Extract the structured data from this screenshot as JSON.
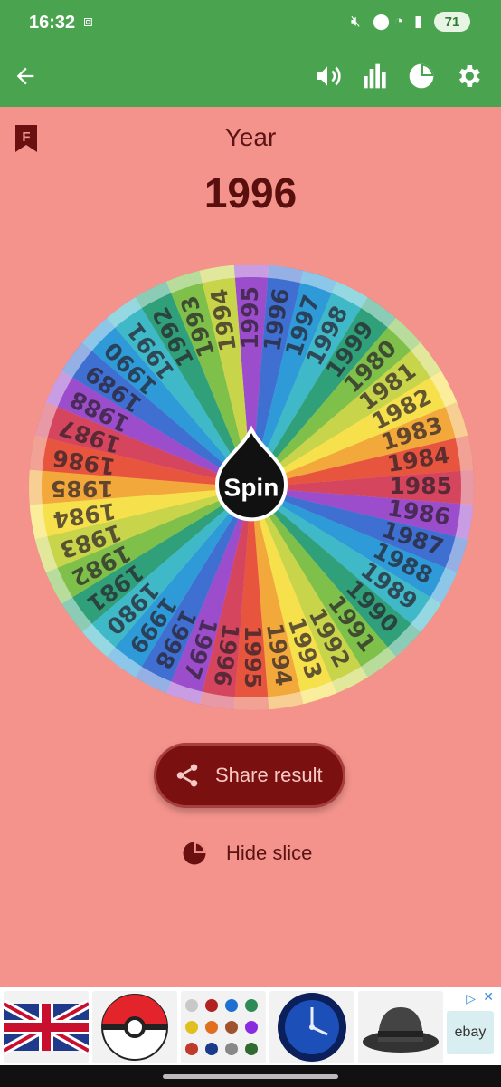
{
  "status": {
    "time": "16:32",
    "battery": "71",
    "icons": [
      "screenshot-icon",
      "mute-icon",
      "location-icon",
      "wifi-icon",
      "signal-icon"
    ]
  },
  "appbar": {
    "back": "back-arrow-icon",
    "actions": [
      "volume-icon",
      "stats-icon",
      "pie-icon",
      "settings-icon"
    ]
  },
  "wheel_title": "Year",
  "result": "1996",
  "spin_label": "Spin",
  "wheel": {
    "labels": [
      "1995",
      "1996",
      "1997",
      "1998",
      "1999",
      "1980",
      "1981",
      "1982",
      "1983",
      "1984",
      "1985",
      "1986",
      "1987",
      "1988",
      "1989",
      "1990",
      "1991",
      "1992",
      "1993",
      "1994"
    ],
    "colors": [
      "#9c4dcc",
      "#3f6fd0",
      "#2e9ad8",
      "#3fb8c8",
      "#2fa07a",
      "#7fc04a",
      "#c8d44a",
      "#f6e14c",
      "#f2a83a",
      "#e8553f",
      "#d6455e"
    ]
  },
  "share_label": "Share result",
  "hide_label": "Hide slice",
  "ads": {
    "tiles": [
      "uk-flag",
      "pokeball",
      "color-dots",
      "wall-clock",
      "fedora-hat",
      "ebay"
    ],
    "ebay_text": "ebay"
  }
}
